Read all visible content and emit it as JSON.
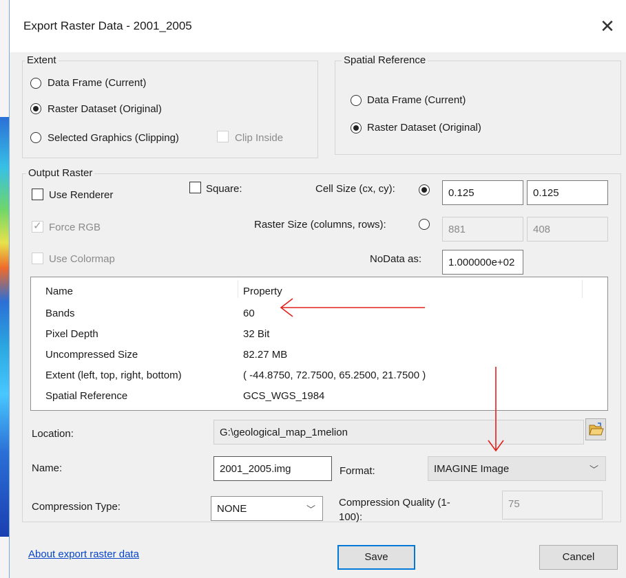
{
  "window": {
    "title": "Export Raster Data - 2001_2005"
  },
  "extent": {
    "label": "Extent",
    "options": [
      "Data Frame (Current)",
      "Raster Dataset (Original)",
      "Selected Graphics (Clipping)"
    ],
    "selected": "Raster Dataset (Original)",
    "clip_inside": {
      "label": "Clip Inside",
      "checked": false,
      "enabled": false
    }
  },
  "spatial_reference": {
    "label": "Spatial Reference",
    "options": [
      "Data Frame (Current)",
      "Raster Dataset (Original)"
    ],
    "selected": "Raster Dataset (Original)"
  },
  "output_raster": {
    "label": "Output Raster",
    "use_renderer": {
      "label": "Use Renderer",
      "checked": false
    },
    "force_rgb": {
      "label": "Force RGB",
      "checked": true,
      "enabled": false
    },
    "use_colormap": {
      "label": "Use Colormap",
      "checked": false,
      "enabled": false
    },
    "square": {
      "label": "Square:",
      "checked": false
    },
    "cell_size": {
      "label": "Cell Size (cx, cy):",
      "selected": true,
      "cx": "0.125",
      "cy": "0.125"
    },
    "raster_size": {
      "label": "Raster Size (columns, rows):",
      "selected": false,
      "columns": "881",
      "rows": "408"
    },
    "nodata": {
      "label": "NoData as:",
      "value": "1.000000e+02"
    }
  },
  "properties": {
    "headers": [
      "Name",
      "Property"
    ],
    "rows": [
      [
        "Bands",
        "60"
      ],
      [
        "Pixel Depth",
        "32 Bit"
      ],
      [
        "Uncompressed Size",
        "82.27 MB"
      ],
      [
        "Extent (left, top, right, bottom)",
        "( -44.8750, 72.7500, 65.2500, 21.7500 )"
      ],
      [
        "Spatial Reference",
        "GCS_WGS_1984"
      ]
    ]
  },
  "location": {
    "label": "Location:",
    "value": "G:\\geological_map_1melion"
  },
  "name": {
    "label": "Name:",
    "value": "2001_2005.img"
  },
  "format": {
    "label": "Format:",
    "value": "IMAGINE Image"
  },
  "compression_type": {
    "label": "Compression Type:",
    "value": "NONE"
  },
  "compression_quality": {
    "label": "Compression Quality (1-100):",
    "value": "75"
  },
  "footer": {
    "help_link": "About export raster data",
    "save": "Save",
    "cancel": "Cancel"
  },
  "annotations": {
    "arrow_color": "#e0201a"
  }
}
